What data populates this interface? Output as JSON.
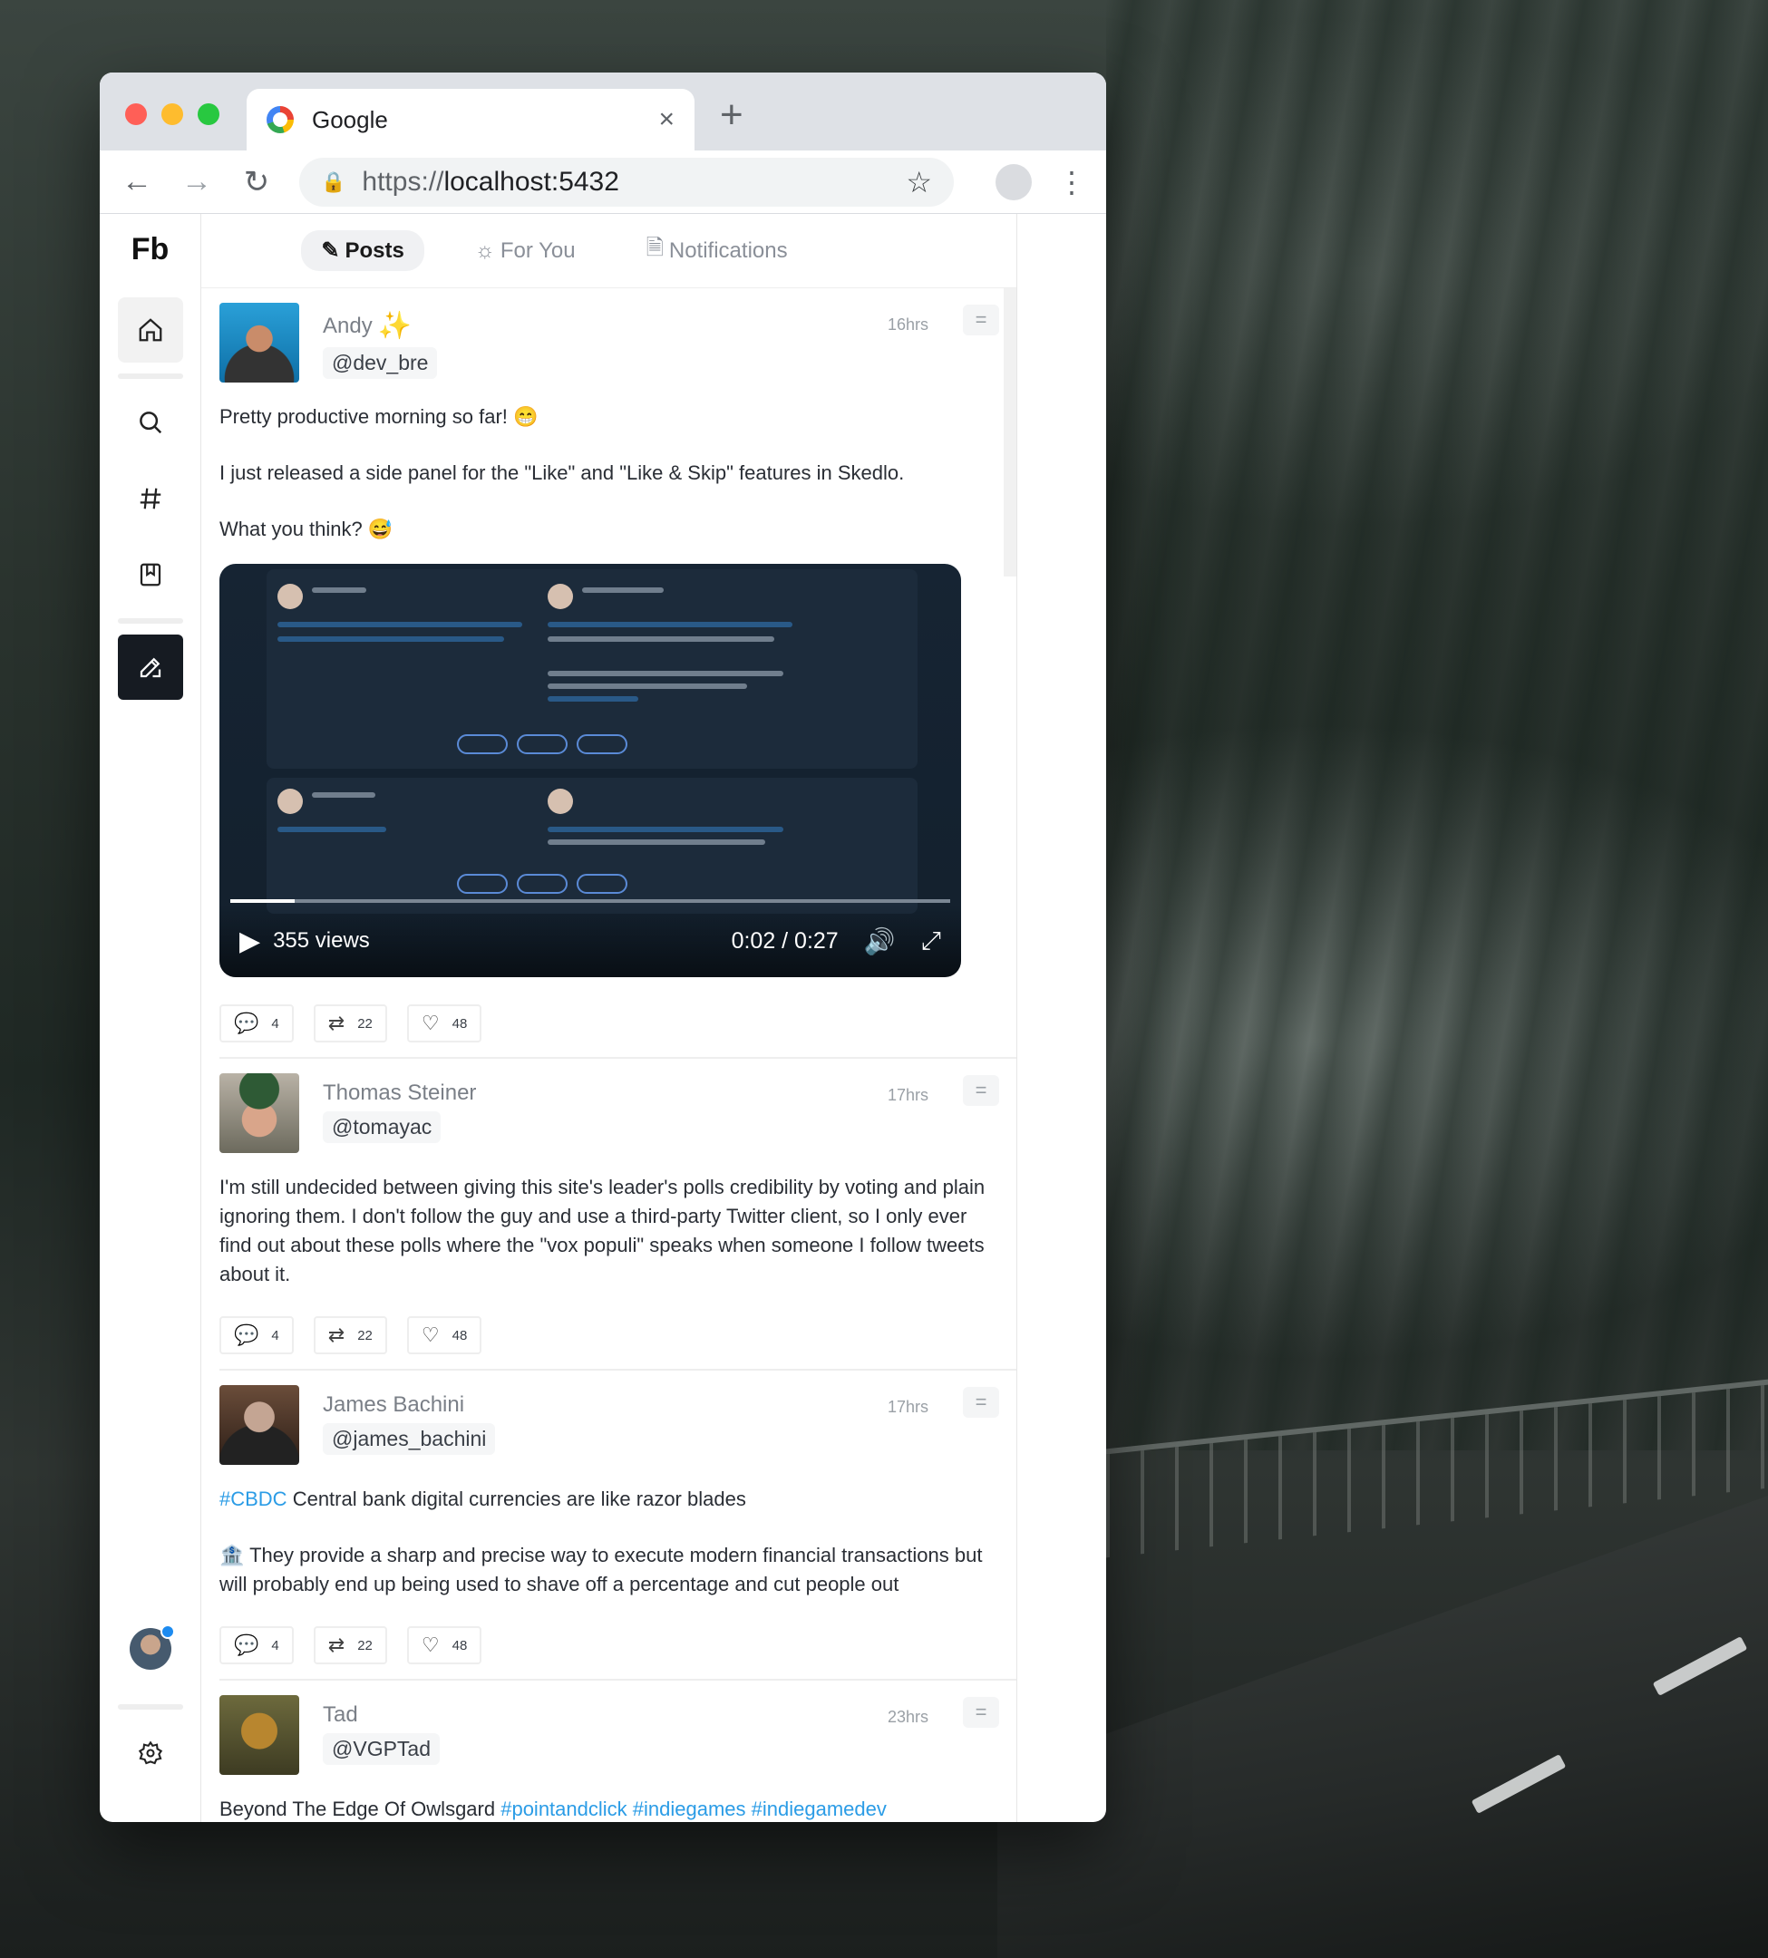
{
  "browser": {
    "tab_title": "Google",
    "tab_close": "×",
    "new_tab": "+",
    "url_scheme": "https://",
    "url_host": "localhost:5432"
  },
  "app": {
    "logo": "Fb",
    "tabs": [
      {
        "label": "Posts",
        "icon": "pencil-icon",
        "active": true
      },
      {
        "label": "For You",
        "icon": "sun-icon",
        "active": false
      },
      {
        "label": "Notifications",
        "icon": "file-icon",
        "active": false
      }
    ]
  },
  "posts": [
    {
      "name": "Andy",
      "handle": "@dev_bre",
      "time": "16hrs",
      "paragraphs": [
        "Pretty productive morning so far! 😁",
        "I just released a side panel for the \"Like\" and \"Like & Skip\" features in Skedlo.",
        "What you think?  😅"
      ],
      "video": {
        "views": "355 views",
        "time": "0:02 / 0:27",
        "progress": 0.09
      },
      "comments": "4",
      "reposts": "22",
      "likes": "48"
    },
    {
      "name": "Thomas Steiner",
      "handle": "@tomayac",
      "time": "17hrs",
      "paragraphs": [
        "I'm still undecided between giving this site's leader's polls credibility by voting and plain ignoring them. I don't follow the guy and use a third-party Twitter client, so I only ever find out about these polls where the \"vox populi\" speaks when someone I follow tweets about it."
      ],
      "comments": "4",
      "reposts": "22",
      "likes": "48"
    },
    {
      "name": "James Bachini",
      "handle": "@james_bachini",
      "time": "17hrs",
      "hashtag": "#CBDC",
      "line1": " Central bank digital currencies are like razor blades",
      "line2": "🏦 They provide a sharp and precise way to execute modern financial transactions but will probably end up being used to shave off a percentage and cut people out",
      "comments": "4",
      "reposts": "22",
      "likes": "48"
    },
    {
      "name": "Tad",
      "handle": "@VGPTad",
      "time": "23hrs",
      "text": "Beyond The Edge Of Owlsgard ",
      "tags": [
        "#pointandclick",
        "#indiegames",
        "#indiegamedev"
      ]
    }
  ]
}
